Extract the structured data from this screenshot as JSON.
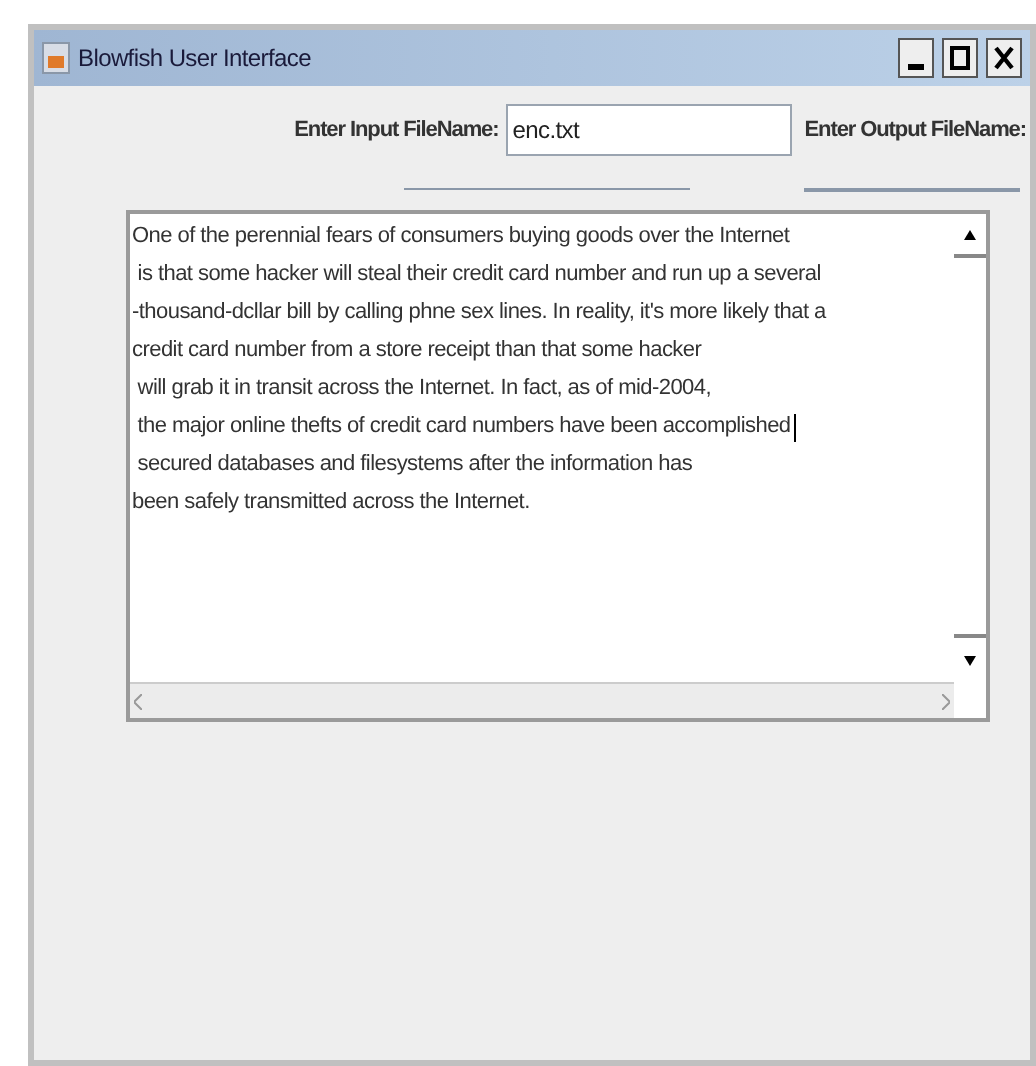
{
  "window": {
    "title": "Blowfish User Interface"
  },
  "input_file": {
    "label": "Enter Input FileName:",
    "value": "enc.txt"
  },
  "output_file": {
    "label": "Enter Output FileName:"
  },
  "text_area": {
    "lines": [
      {
        "text": "One of the perennial fears of consumers buying goods over the Internet",
        "caret": false
      },
      {
        "text": " is that some hacker will steal their credit card number and run up a several",
        "caret": false
      },
      {
        "text": "-thousand-dcllar bill by calling phne sex lines. In reality, it's more likely that a",
        "caret": false
      },
      {
        "text": "credit card number from a store receipt than that some hacker",
        "caret": false
      },
      {
        "text": " will grab it in transit across the Internet. In fact, as of mid-2004,",
        "caret": false
      },
      {
        "text": " the major online thefts of credit card numbers have been accomplished",
        "caret": true
      },
      {
        "text": " secured databases and filesystems after the information has",
        "caret": false
      },
      {
        "text": "been safely transmitted across the Internet.",
        "caret": false
      }
    ]
  }
}
